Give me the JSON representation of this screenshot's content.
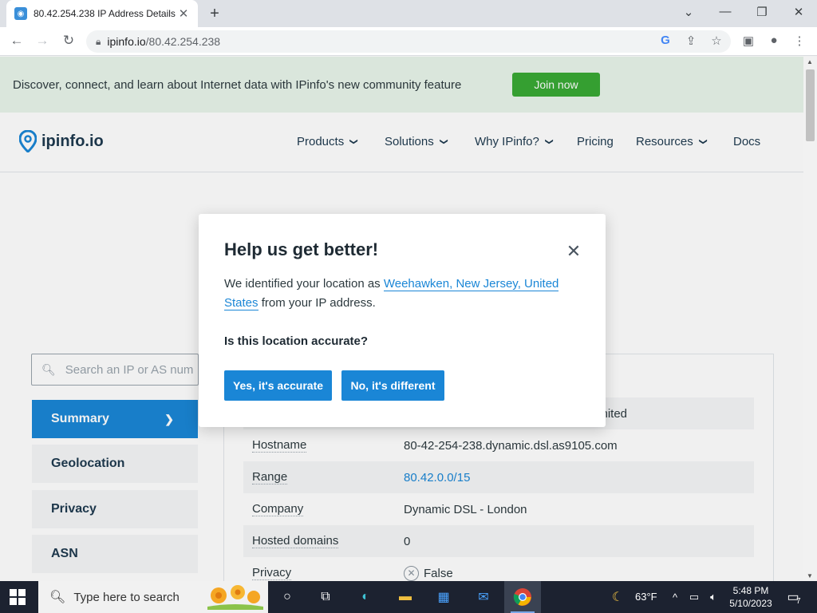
{
  "browser": {
    "tab_title": "80.42.254.238 IP Address Details -",
    "tab_close": "✕",
    "new_tab": "+",
    "url_host": "ipinfo.io",
    "url_path": "/80.42.254.238",
    "window_controls": [
      "⌄",
      "—",
      "❐",
      "✕"
    ]
  },
  "banner": {
    "text": "Discover, connect, and learn about Internet data with IPinfo's new community feature",
    "join_label": "Join now"
  },
  "header": {
    "logo_text": "ipinfo.io",
    "nav": [
      {
        "label": "Products",
        "has_menu": true
      },
      {
        "label": "Solutions",
        "has_menu": true
      },
      {
        "label": "Why IPinfo?",
        "has_menu": true
      },
      {
        "label": "Pricing",
        "has_menu": false
      },
      {
        "label": "Resources",
        "has_menu": true
      },
      {
        "label": "Docs",
        "has_menu": false
      }
    ]
  },
  "search": {
    "placeholder": "Search an IP or AS number"
  },
  "sidebar": {
    "items": [
      {
        "label": "Summary",
        "active": true
      },
      {
        "label": "Geolocation",
        "active": false
      },
      {
        "label": "Privacy",
        "active": false
      },
      {
        "label": "ASN",
        "active": false
      }
    ]
  },
  "summary": {
    "partial_value": "imited",
    "rows": [
      {
        "key": "Hostname",
        "value": "80-42-254-238.dynamic.dsl.as9105.com"
      },
      {
        "key": "Range",
        "value": "80.42.0.0/15"
      },
      {
        "key": "Company",
        "value": "Dynamic DSL - London"
      },
      {
        "key": "Hosted domains",
        "value": "0"
      },
      {
        "key": "Privacy",
        "value": "False"
      }
    ]
  },
  "modal": {
    "title": "Help us get better!",
    "body_prefix": "We identified your location as ",
    "location": "Weehawken, New Jersey, United States",
    "body_suffix": " from your IP address.",
    "question": "Is this location accurate?",
    "yes_label": "Yes, it's accurate",
    "no_label": "No, it's different"
  },
  "taskbar": {
    "search_text": "Type here to search",
    "weather": "63°F",
    "time": "5:48 PM",
    "date": "5/10/2023",
    "notifications": "7"
  },
  "colors": {
    "accent": "#1a86d6",
    "join_green": "#39a935",
    "banner_bg": "#e8f5ea"
  }
}
